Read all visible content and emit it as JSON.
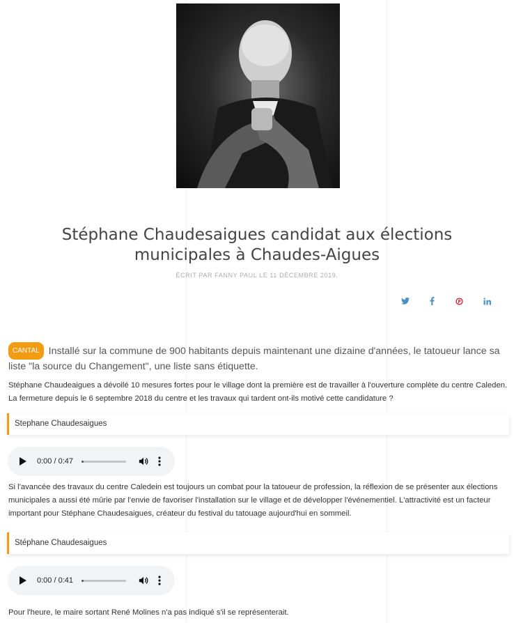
{
  "article": {
    "title": "Stéphane Chaudesaigues candidat aux élections municipales à Chaudes-Aigues",
    "byline": "ÉCRIT PAR FANNY PAUL LE 11 DÉCEMBRE 2019.",
    "hero_image": "portrait-photo",
    "tag": "CANTAL",
    "lead": "Installé sur la commune de 900 habitants depuis maintenant une dizaine d'années, le tatoueur lance sa liste \"la source du Changement\", une liste sans étiquette.",
    "paragraph1": "Stéphane Chaudeaigues a dévoilé 10 mesures fortes pour le village dont la première est de travailler à l'ouverture complète du centre Caleden. La fermeture depuis le 6 septembre 2018 du centre et les travaux qui tardent ont-ils motivé cette candidature ?",
    "paragraph2": "Si l'avancée des travaux du centre Caledein est toujours un combat pour la tatoueur de profession, la réflexion de se présenter aux élections municipales a aussi été mûrie par l'envie de favoriser l'installation sur le village et de développer l'événementiel. L'attractivité est un facteur important pour Stéphane Chaudesaigues, créateur du festival du tatouage aujourd'hui en sommeil.",
    "paragraph3": "Pour l'heure, le maire sortant René Molines n'a pas indiqué s'il se représenterait."
  },
  "share": {
    "icons": [
      "twitter-icon",
      "facebook-icon",
      "pinterest-icon",
      "linkedin-icon"
    ],
    "color": "#4a90c2",
    "pinterest_color": "#cb2027"
  },
  "audio_blocks": [
    {
      "label": "Stephane Chaudesaigues",
      "time": "0:00 / 0:47",
      "progress": 0.04
    },
    {
      "label": "Stéphane Chaudesaigues",
      "time": "0:00 / 0:41",
      "progress": 0.04
    }
  ],
  "colors": {
    "accent": "#f39c12",
    "text": "#333333",
    "title": "#444444"
  }
}
